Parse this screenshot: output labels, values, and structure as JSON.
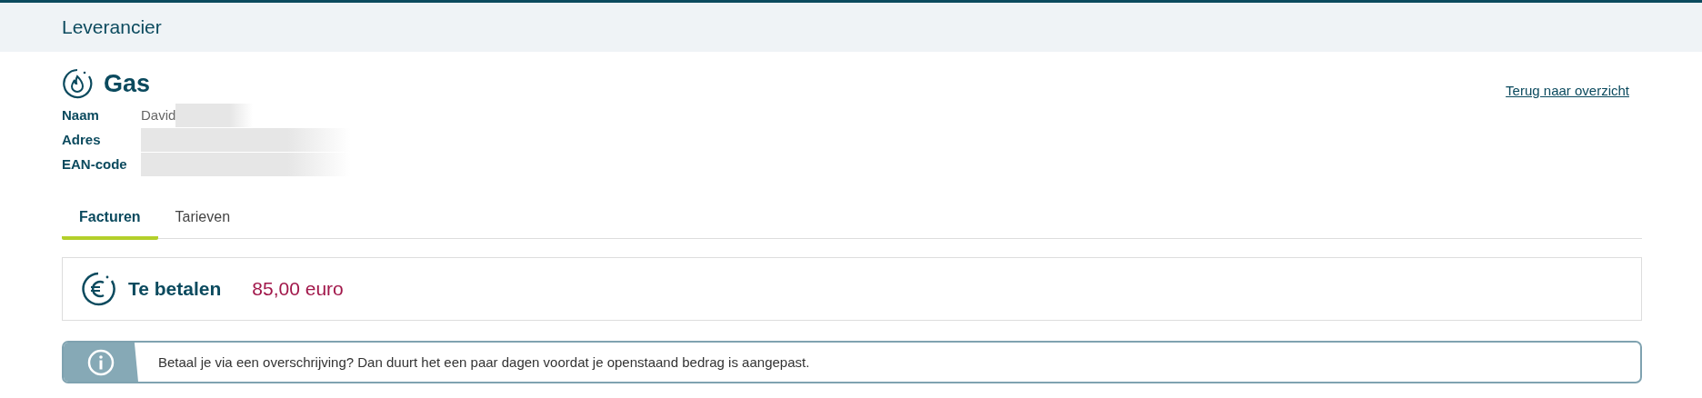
{
  "header": {
    "title": "Leverancier"
  },
  "product": {
    "title": "Gas",
    "back_link": "Terug naar overzicht"
  },
  "details": [
    {
      "label": "Naam",
      "value": "David",
      "redacted": true
    },
    {
      "label": "Adres",
      "redacted": true
    },
    {
      "label": "EAN-code",
      "redacted": true
    }
  ],
  "tabs": [
    {
      "label": "Facturen",
      "selected": true
    },
    {
      "label": "Tarieven",
      "selected": false
    }
  ],
  "payment": {
    "label": "Te betalen",
    "amount": "85,00 euro"
  },
  "notice": {
    "text": "Betaal je via een overschrijving? Dan duurt het een paar dagen voordat je openstaand bedrag is aangepast."
  }
}
